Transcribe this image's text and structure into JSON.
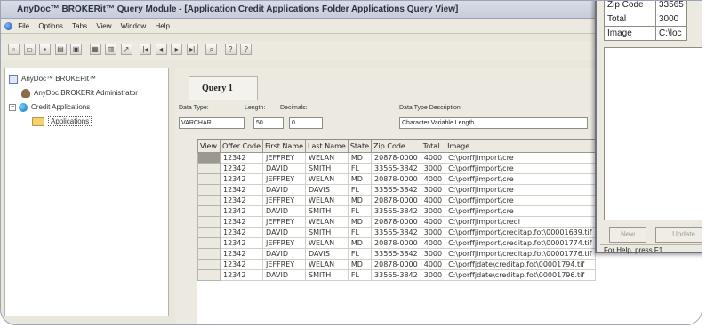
{
  "window": {
    "title": "AnyDoc™ BROKERit™ Query Module - [Application Credit Applications Folder Applications Query View]"
  },
  "menu": {
    "items": [
      "File",
      "Options",
      "Tabs",
      "View",
      "Window",
      "Help"
    ]
  },
  "toolbar": {
    "icons": [
      "new-icon",
      "open-icon",
      "save-icon",
      "print-icon",
      "preview-icon",
      "grid-icon",
      "table-icon",
      "export-icon",
      "first-icon",
      "prev-icon",
      "next-icon",
      "last-icon",
      "search-icon",
      "help-icon",
      "context-help-icon"
    ]
  },
  "tree": {
    "root": "AnyDoc™ BROKERit™",
    "admin": "AnyDoc BROKERit Administrator",
    "group": "Credit Applications",
    "folder": "Applications"
  },
  "query": {
    "tab_label": "Query 1",
    "data_type_label": "Data Type:",
    "length_label": "Length:",
    "decimals_label": "Decimals:",
    "desc_label": "Data Type Description:",
    "data_type_value": "VARCHAR",
    "length_value": "50",
    "decimals_value": "0",
    "desc_value": "Character Variable Length"
  },
  "grid": {
    "columns": [
      "View",
      "Offer Code",
      "First Name",
      "Last Name",
      "State",
      "Zip Code",
      "Total",
      "Image"
    ],
    "rows": [
      [
        "12342",
        "JEFFREY",
        "WELAN",
        "MD",
        "20878-0000",
        "4000",
        "C:\\porffjimport\\cre"
      ],
      [
        "12342",
        "DAVID",
        "SMITH",
        "FL",
        "33565-3842",
        "3000",
        "C:\\porffjimport\\cre"
      ],
      [
        "12342",
        "JEFFREY",
        "WELAN",
        "MD",
        "20878-0000",
        "4000",
        "C:\\porffjimport\\cre"
      ],
      [
        "12342",
        "DAVID",
        "DAVIS",
        "FL",
        "33565-3842",
        "3000",
        "C:\\porffjimport\\cre"
      ],
      [
        "12342",
        "JEFFREY",
        "WELAN",
        "MD",
        "20878-0000",
        "4000",
        "C:\\porffjimport\\cre"
      ],
      [
        "12342",
        "DAVID",
        "SMITH",
        "FL",
        "33565-3842",
        "3000",
        "C:\\porffjimport\\cre"
      ],
      [
        "12342",
        "JEFFREY",
        "WELAN",
        "MD",
        "20878-0000",
        "4000",
        "C:\\porffjimport\\credi"
      ],
      [
        "12342",
        "DAVID",
        "SMITH",
        "FL",
        "33565-3842",
        "3000",
        "C:\\porffjimport\\creditap.fot\\00001639.tif"
      ],
      [
        "12342",
        "JEFFREY",
        "WELAN",
        "MD",
        "20878-0000",
        "4000",
        "C:\\porffjimport\\creditap.fot\\00001774.tif"
      ],
      [
        "12342",
        "DAVID",
        "DAVIS",
        "FL",
        "33565-3842",
        "3000",
        "C:\\porffjimport\\creditap.fot\\00001776.tif"
      ],
      [
        "12342",
        "JEFFREY",
        "WELAN",
        "MD",
        "20878-0000",
        "4000",
        "C:\\porffjdate\\creditap.fot\\00001794.tif"
      ],
      [
        "12342",
        "DAVID",
        "SMITH",
        "FL",
        "33565-3842",
        "3000",
        "C:\\porffjdate\\creditap.fot\\00001796.tif"
      ]
    ]
  },
  "record_popup": {
    "fields": [
      {
        "key": "Zip Code",
        "value": "33565"
      },
      {
        "key": "Total",
        "value": "3000"
      },
      {
        "key": "Image",
        "value": "C:\\loc"
      }
    ],
    "new_label": "New",
    "update_label": "Update",
    "status": "For Help, press F1"
  }
}
